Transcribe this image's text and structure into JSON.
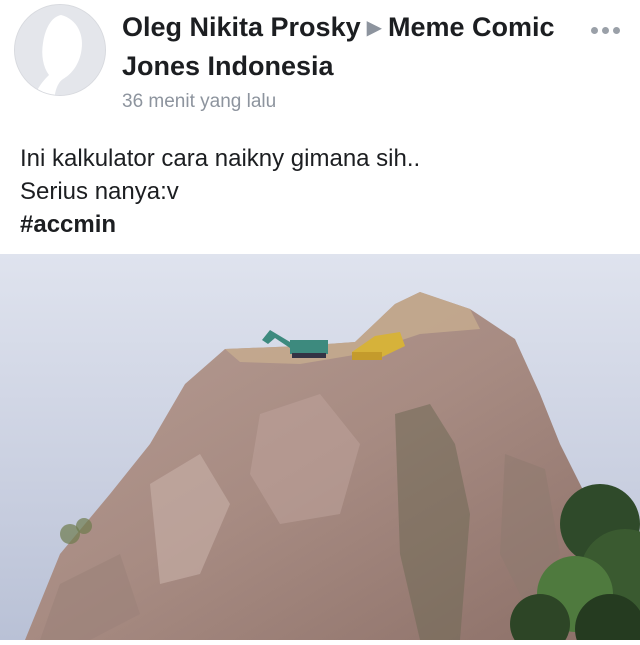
{
  "post": {
    "author": "Oleg Nikita Prosky",
    "separator_icon": "triangle-right-icon",
    "group": "Meme Comic Jones Indonesia",
    "timestamp": "36 menit yang lalu",
    "more_icon": "more-horizontal-icon",
    "text_lines": [
      "Ini kalkulator cara naikny gimana sih..",
      "Serius nanya:v"
    ],
    "hashtag": "#accmin",
    "image_subject": "excavators on top of a steep rocky hill"
  },
  "colors": {
    "name_text": "#1c1e21",
    "meta_text": "#8d949e",
    "sky": "#c9cfe0",
    "rock": "#a78b82"
  }
}
